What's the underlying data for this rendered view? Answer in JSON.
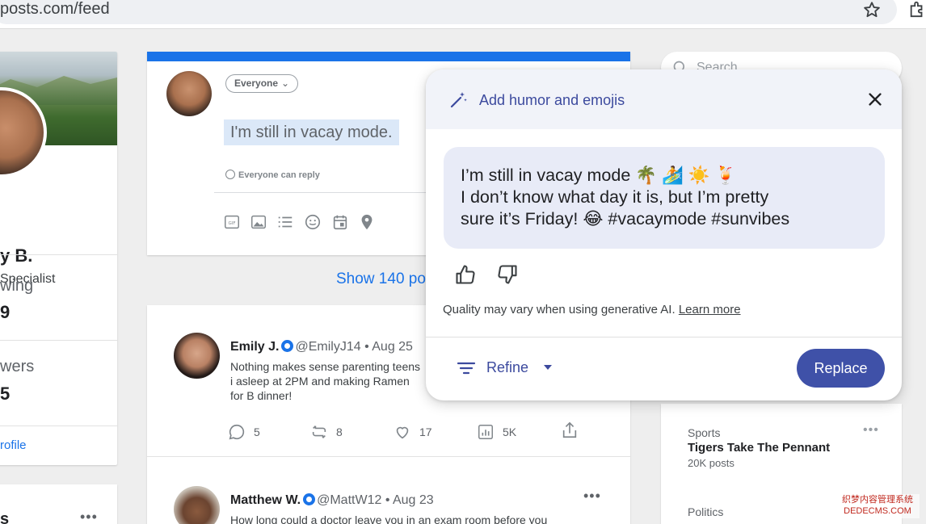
{
  "browser": {
    "url": "posts.com/feed"
  },
  "profile": {
    "name": "y B.",
    "title": "Specialist",
    "stats": [
      {
        "label": "wing",
        "value": "9"
      },
      {
        "label": "wers",
        "value": "5"
      }
    ],
    "link": "rofile",
    "second_card_title": "s",
    "second_card_more": "•••"
  },
  "compose": {
    "audience": "Everyone",
    "draft": "I'm still in vacay mode.",
    "reply_setting": "Everyone can reply"
  },
  "feed": {
    "show_posts": "Show 140 pos",
    "posts": [
      {
        "author": "Emily J.",
        "handle": "@EmilyJ14 • Aug 25",
        "text": "Nothing makes sense parenting teens i asleep at 2PM and making Ramen for B dinner!",
        "replies": "5",
        "reposts": "8",
        "likes": "17",
        "views": "5K"
      },
      {
        "author": "Matthew W.",
        "handle": "@MattW12 • Aug 23",
        "text": "How long could a doctor leave you in an exam room before you",
        "more": "•••"
      }
    ]
  },
  "sidebar": {
    "search_placeholder": "Search",
    "trends": [
      {
        "category": "Sports",
        "title": "Tigers Take The Pennant",
        "count": "20K posts",
        "more": "•••"
      },
      {
        "category": "Politics"
      }
    ]
  },
  "ai_popup": {
    "title": "Add humor and emojis",
    "suggestion_lines": [
      "I’m still in vacay mode 🌴 🏄 ☀️ 🍹",
      "I don’t know what day it is, but I’m pretty",
      "sure it’s Friday! 😂 #vacaymode #sunvibes"
    ],
    "disclaimer": "Quality may vary when using generative AI.",
    "learn_more": "Learn more",
    "refine_label": "Refine",
    "replace_label": "Replace"
  },
  "watermark": [
    "织梦内容管理系统",
    "DEDECMS.COM"
  ],
  "colors": {
    "accent": "#1a73e8",
    "ai_primary": "#3f51a8",
    "ai_text": "#3c4a9e",
    "bubble": "#e8ebf7"
  }
}
